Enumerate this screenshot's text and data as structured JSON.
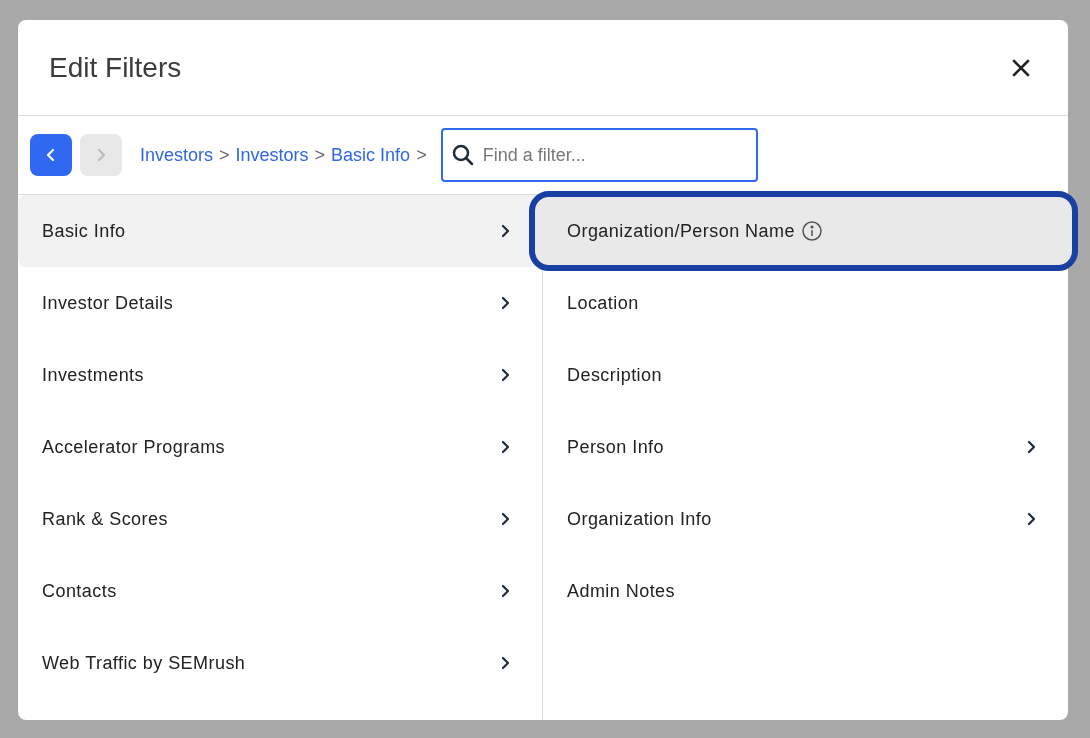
{
  "dialog": {
    "title": "Edit Filters"
  },
  "navigation": {
    "back_disabled": false,
    "forward_disabled": true
  },
  "breadcrumb": [
    {
      "label": "Investors",
      "separator": ">"
    },
    {
      "label": "Investors",
      "separator": ">"
    },
    {
      "label": "Basic Info",
      "separator": ">"
    }
  ],
  "search": {
    "placeholder": "Find a filter..."
  },
  "categories": [
    {
      "label": "Basic Info",
      "selected": true
    },
    {
      "label": "Investor Details",
      "selected": false
    },
    {
      "label": "Investments",
      "selected": false
    },
    {
      "label": "Accelerator Programs",
      "selected": false
    },
    {
      "label": "Rank & Scores",
      "selected": false
    },
    {
      "label": "Contacts",
      "selected": false
    },
    {
      "label": "Web Traffic by SEMrush",
      "selected": false
    }
  ],
  "filters": [
    {
      "label": "Organization/Person Name",
      "info": true,
      "has_children": false,
      "selected": true,
      "highlighted": true
    },
    {
      "label": "Location",
      "info": false,
      "has_children": false,
      "selected": false,
      "highlighted": false
    },
    {
      "label": "Description",
      "info": false,
      "has_children": false,
      "selected": false,
      "highlighted": false
    },
    {
      "label": "Person Info",
      "info": false,
      "has_children": true,
      "selected": false,
      "highlighted": false
    },
    {
      "label": "Organization Info",
      "info": false,
      "has_children": true,
      "selected": false,
      "highlighted": false
    },
    {
      "label": "Admin Notes",
      "info": false,
      "has_children": false,
      "selected": false,
      "highlighted": false
    }
  ]
}
